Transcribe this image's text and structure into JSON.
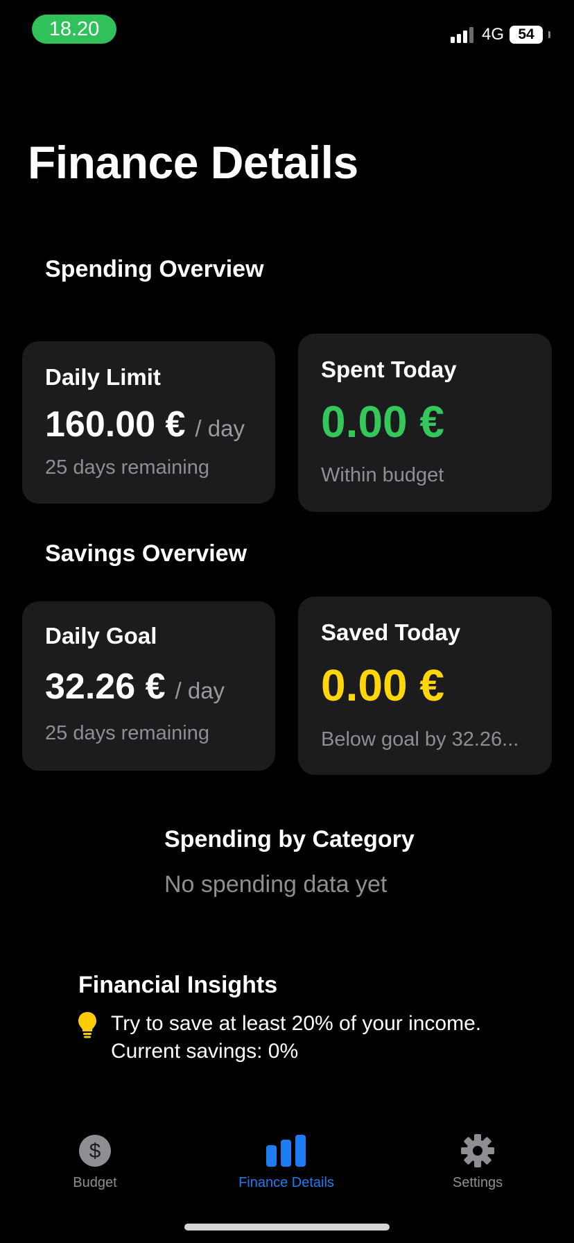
{
  "status_bar": {
    "time": "18.20",
    "network": "4G",
    "battery": "54"
  },
  "page_title": "Finance Details",
  "spending_overview": {
    "title": "Spending Overview",
    "daily_limit": {
      "label": "Daily Limit",
      "value": "160.00 €",
      "unit": "/ day",
      "sub": "25 days remaining"
    },
    "spent_today": {
      "label": "Spent Today",
      "value": "0.00 €",
      "sub": "Within budget"
    }
  },
  "savings_overview": {
    "title": "Savings Overview",
    "daily_goal": {
      "label": "Daily Goal",
      "value": "32.26 €",
      "unit": "/ day",
      "sub": "25 days remaining"
    },
    "saved_today": {
      "label": "Saved Today",
      "value": "0.00 €",
      "sub": "Below goal by 32.26..."
    }
  },
  "spending_by_category": {
    "title": "Spending by Category",
    "empty_text": "No spending data yet"
  },
  "insights": {
    "title": "Financial Insights",
    "line1": "Try to save at least 20% of your income.",
    "line2": "Current savings: 0%"
  },
  "tab_bar": {
    "tabs": [
      {
        "label": "Budget",
        "icon": "dollar-circle-icon",
        "active": false
      },
      {
        "label": "Finance Details",
        "icon": "bar-chart-icon",
        "active": true
      },
      {
        "label": "Settings",
        "icon": "gear-icon",
        "active": false
      }
    ]
  },
  "colors": {
    "background": "#000000",
    "card": "#1c1c1e",
    "green": "#34c759",
    "yellow": "#ffd60a",
    "accent_blue": "#1e7cf2",
    "secondary_text": "#8e8e93"
  }
}
